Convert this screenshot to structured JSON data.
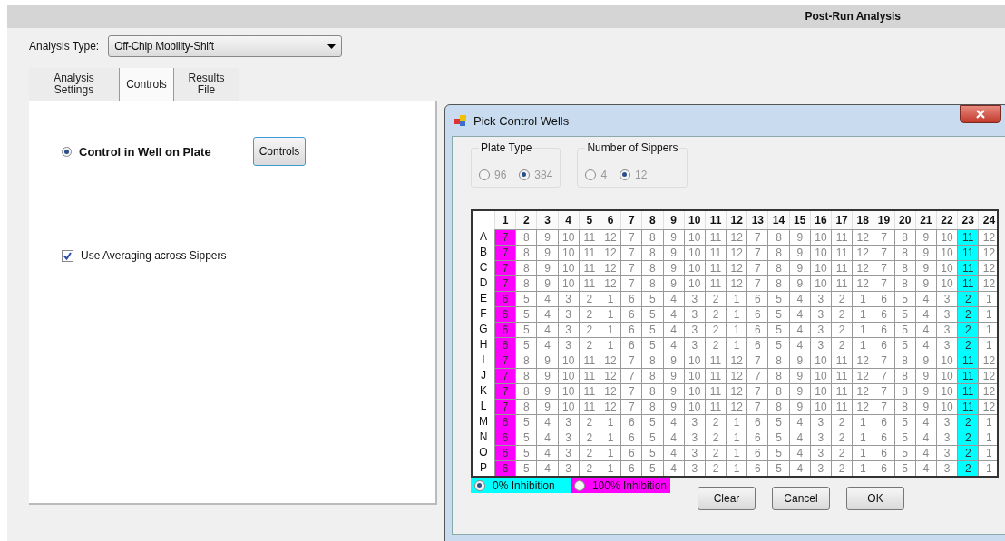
{
  "window": {
    "title": "Post-Run Analysis"
  },
  "analysis_type": {
    "label": "Analysis Type:",
    "value": "Off-Chip Mobility-Shift"
  },
  "tabs": [
    {
      "label": "Analysis Settings",
      "selected": false
    },
    {
      "label": "Controls",
      "selected": true
    },
    {
      "label": "Results File",
      "selected": false
    }
  ],
  "controls_tab": {
    "radio": {
      "label": "Control in Well on Plate",
      "selected": true
    },
    "button": "Controls",
    "checkbox": {
      "label": "Use Averaging across Sippers",
      "checked": true
    }
  },
  "dialog": {
    "title": "Pick Control Wells",
    "groups": [
      {
        "title": "Plate Type",
        "disabled": true,
        "options": [
          {
            "label": "96",
            "selected": false
          },
          {
            "label": "384",
            "selected": true
          }
        ]
      },
      {
        "title": "Number of Sippers",
        "disabled": true,
        "options": [
          {
            "label": "4",
            "selected": false
          },
          {
            "label": "12",
            "selected": true
          }
        ]
      }
    ],
    "columns": [
      {
        "label": "1",
        "color": "#ff00ff"
      },
      {
        "label": "2"
      },
      {
        "label": "3"
      },
      {
        "label": "4"
      },
      {
        "label": "5"
      },
      {
        "label": "6"
      },
      {
        "label": "7"
      },
      {
        "label": "8"
      },
      {
        "label": "9"
      },
      {
        "label": "10"
      },
      {
        "label": "11"
      },
      {
        "label": "12"
      },
      {
        "label": "13"
      },
      {
        "label": "14"
      },
      {
        "label": "15"
      },
      {
        "label": "16"
      },
      {
        "label": "17"
      },
      {
        "label": "18"
      },
      {
        "label": "19"
      },
      {
        "label": "20"
      },
      {
        "label": "21"
      },
      {
        "label": "22"
      },
      {
        "label": "23",
        "color": "#00ffff"
      },
      {
        "label": "24"
      }
    ],
    "rows": [
      {
        "label": "A",
        "cells": [
          "7",
          "8",
          "9",
          "10",
          "11",
          "12",
          "7",
          "8",
          "9",
          "10",
          "11",
          "12",
          "7",
          "8",
          "9",
          "10",
          "11",
          "12",
          "7",
          "8",
          "9",
          "10",
          "11",
          "12"
        ]
      },
      {
        "label": "B",
        "cells": [
          "7",
          "8",
          "9",
          "10",
          "11",
          "12",
          "7",
          "8",
          "9",
          "10",
          "11",
          "12",
          "7",
          "8",
          "9",
          "10",
          "11",
          "12",
          "7",
          "8",
          "9",
          "10",
          "11",
          "12"
        ]
      },
      {
        "label": "C",
        "cells": [
          "7",
          "8",
          "9",
          "10",
          "11",
          "12",
          "7",
          "8",
          "9",
          "10",
          "11",
          "12",
          "7",
          "8",
          "9",
          "10",
          "11",
          "12",
          "7",
          "8",
          "9",
          "10",
          "11",
          "12"
        ]
      },
      {
        "label": "D",
        "cells": [
          "7",
          "8",
          "9",
          "10",
          "11",
          "12",
          "7",
          "8",
          "9",
          "10",
          "11",
          "12",
          "7",
          "8",
          "9",
          "10",
          "11",
          "12",
          "7",
          "8",
          "9",
          "10",
          "11",
          "12"
        ]
      },
      {
        "label": "E",
        "cells": [
          "6",
          "5",
          "4",
          "3",
          "2",
          "1",
          "6",
          "5",
          "4",
          "3",
          "2",
          "1",
          "6",
          "5",
          "4",
          "3",
          "2",
          "1",
          "6",
          "5",
          "4",
          "3",
          "2",
          "1"
        ]
      },
      {
        "label": "F",
        "cells": [
          "6",
          "5",
          "4",
          "3",
          "2",
          "1",
          "6",
          "5",
          "4",
          "3",
          "2",
          "1",
          "6",
          "5",
          "4",
          "3",
          "2",
          "1",
          "6",
          "5",
          "4",
          "3",
          "2",
          "1"
        ]
      },
      {
        "label": "G",
        "cells": [
          "6",
          "5",
          "4",
          "3",
          "2",
          "1",
          "6",
          "5",
          "4",
          "3",
          "2",
          "1",
          "6",
          "5",
          "4",
          "3",
          "2",
          "1",
          "6",
          "5",
          "4",
          "3",
          "2",
          "1"
        ]
      },
      {
        "label": "H",
        "cells": [
          "6",
          "5",
          "4",
          "3",
          "2",
          "1",
          "6",
          "5",
          "4",
          "3",
          "2",
          "1",
          "6",
          "5",
          "4",
          "3",
          "2",
          "1",
          "6",
          "5",
          "4",
          "3",
          "2",
          "1"
        ]
      },
      {
        "label": "I",
        "cells": [
          "7",
          "8",
          "9",
          "10",
          "11",
          "12",
          "7",
          "8",
          "9",
          "10",
          "11",
          "12",
          "7",
          "8",
          "9",
          "10",
          "11",
          "12",
          "7",
          "8",
          "9",
          "10",
          "11",
          "12"
        ]
      },
      {
        "label": "J",
        "cells": [
          "7",
          "8",
          "9",
          "10",
          "11",
          "12",
          "7",
          "8",
          "9",
          "10",
          "11",
          "12",
          "7",
          "8",
          "9",
          "10",
          "11",
          "12",
          "7",
          "8",
          "9",
          "10",
          "11",
          "12"
        ]
      },
      {
        "label": "K",
        "cells": [
          "7",
          "8",
          "9",
          "10",
          "11",
          "12",
          "7",
          "8",
          "9",
          "10",
          "11",
          "12",
          "7",
          "8",
          "9",
          "10",
          "11",
          "12",
          "7",
          "8",
          "9",
          "10",
          "11",
          "12"
        ]
      },
      {
        "label": "L",
        "cells": [
          "7",
          "8",
          "9",
          "10",
          "11",
          "12",
          "7",
          "8",
          "9",
          "10",
          "11",
          "12",
          "7",
          "8",
          "9",
          "10",
          "11",
          "12",
          "7",
          "8",
          "9",
          "10",
          "11",
          "12"
        ]
      },
      {
        "label": "M",
        "cells": [
          "6",
          "5",
          "4",
          "3",
          "2",
          "1",
          "6",
          "5",
          "4",
          "3",
          "2",
          "1",
          "6",
          "5",
          "4",
          "3",
          "2",
          "1",
          "6",
          "5",
          "4",
          "3",
          "2",
          "1"
        ]
      },
      {
        "label": "N",
        "cells": [
          "6",
          "5",
          "4",
          "3",
          "2",
          "1",
          "6",
          "5",
          "4",
          "3",
          "2",
          "1",
          "6",
          "5",
          "4",
          "3",
          "2",
          "1",
          "6",
          "5",
          "4",
          "3",
          "2",
          "1"
        ]
      },
      {
        "label": "O",
        "cells": [
          "6",
          "5",
          "4",
          "3",
          "2",
          "1",
          "6",
          "5",
          "4",
          "3",
          "2",
          "1",
          "6",
          "5",
          "4",
          "3",
          "2",
          "1",
          "6",
          "5",
          "4",
          "3",
          "2",
          "1"
        ]
      },
      {
        "label": "P",
        "cells": [
          "6",
          "5",
          "4",
          "3",
          "2",
          "1",
          "6",
          "5",
          "4",
          "3",
          "2",
          "1",
          "6",
          "5",
          "4",
          "3",
          "2",
          "1",
          "6",
          "5",
          "4",
          "3",
          "2",
          "1"
        ]
      }
    ],
    "legend": [
      {
        "label": "0% Inhibition",
        "color": "#00ffff",
        "selected": true
      },
      {
        "label": "100% Inhibition",
        "color": "#ff00ff",
        "selected": false
      }
    ],
    "buttons": [
      "Clear",
      "Cancel",
      "OK"
    ]
  }
}
